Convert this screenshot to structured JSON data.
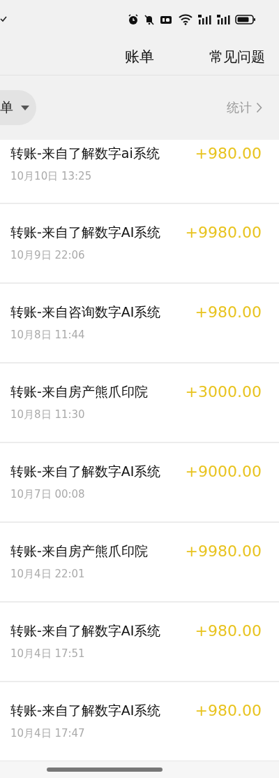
{
  "header": {
    "title": "账单",
    "faq_link": "常见问题"
  },
  "filter": {
    "dropdown": "单",
    "stats_link": "统计"
  },
  "transactions": [
    {
      "title": "转账-来自了解数字ai系统",
      "date": "10月10日 13:25",
      "amount": "+980.00"
    },
    {
      "title": "转账-来自了解数字AI系统",
      "date": "10月9日 22:06",
      "amount": "+9980.00"
    },
    {
      "title": "转账-来自咨询数字AI系统",
      "date": "10月8日 11:44",
      "amount": "+980.00"
    },
    {
      "title": "转账-来自房产熊爪印院",
      "date": "10月8日 11:30",
      "amount": "+3000.00"
    },
    {
      "title": "转账-来自了解数字AI系统",
      "date": "10月7日 00:08",
      "amount": "+9000.00"
    },
    {
      "title": "转账-来自房产熊爪印院",
      "date": "10月4日 22:01",
      "amount": "+9980.00"
    },
    {
      "title": "转账-来自了解数字AI系统",
      "date": "10月4日 17:51",
      "amount": "+980.00"
    },
    {
      "title": "转账-来自了解数字AI系统",
      "date": "10月4日 17:47",
      "amount": "+980.00"
    }
  ]
}
